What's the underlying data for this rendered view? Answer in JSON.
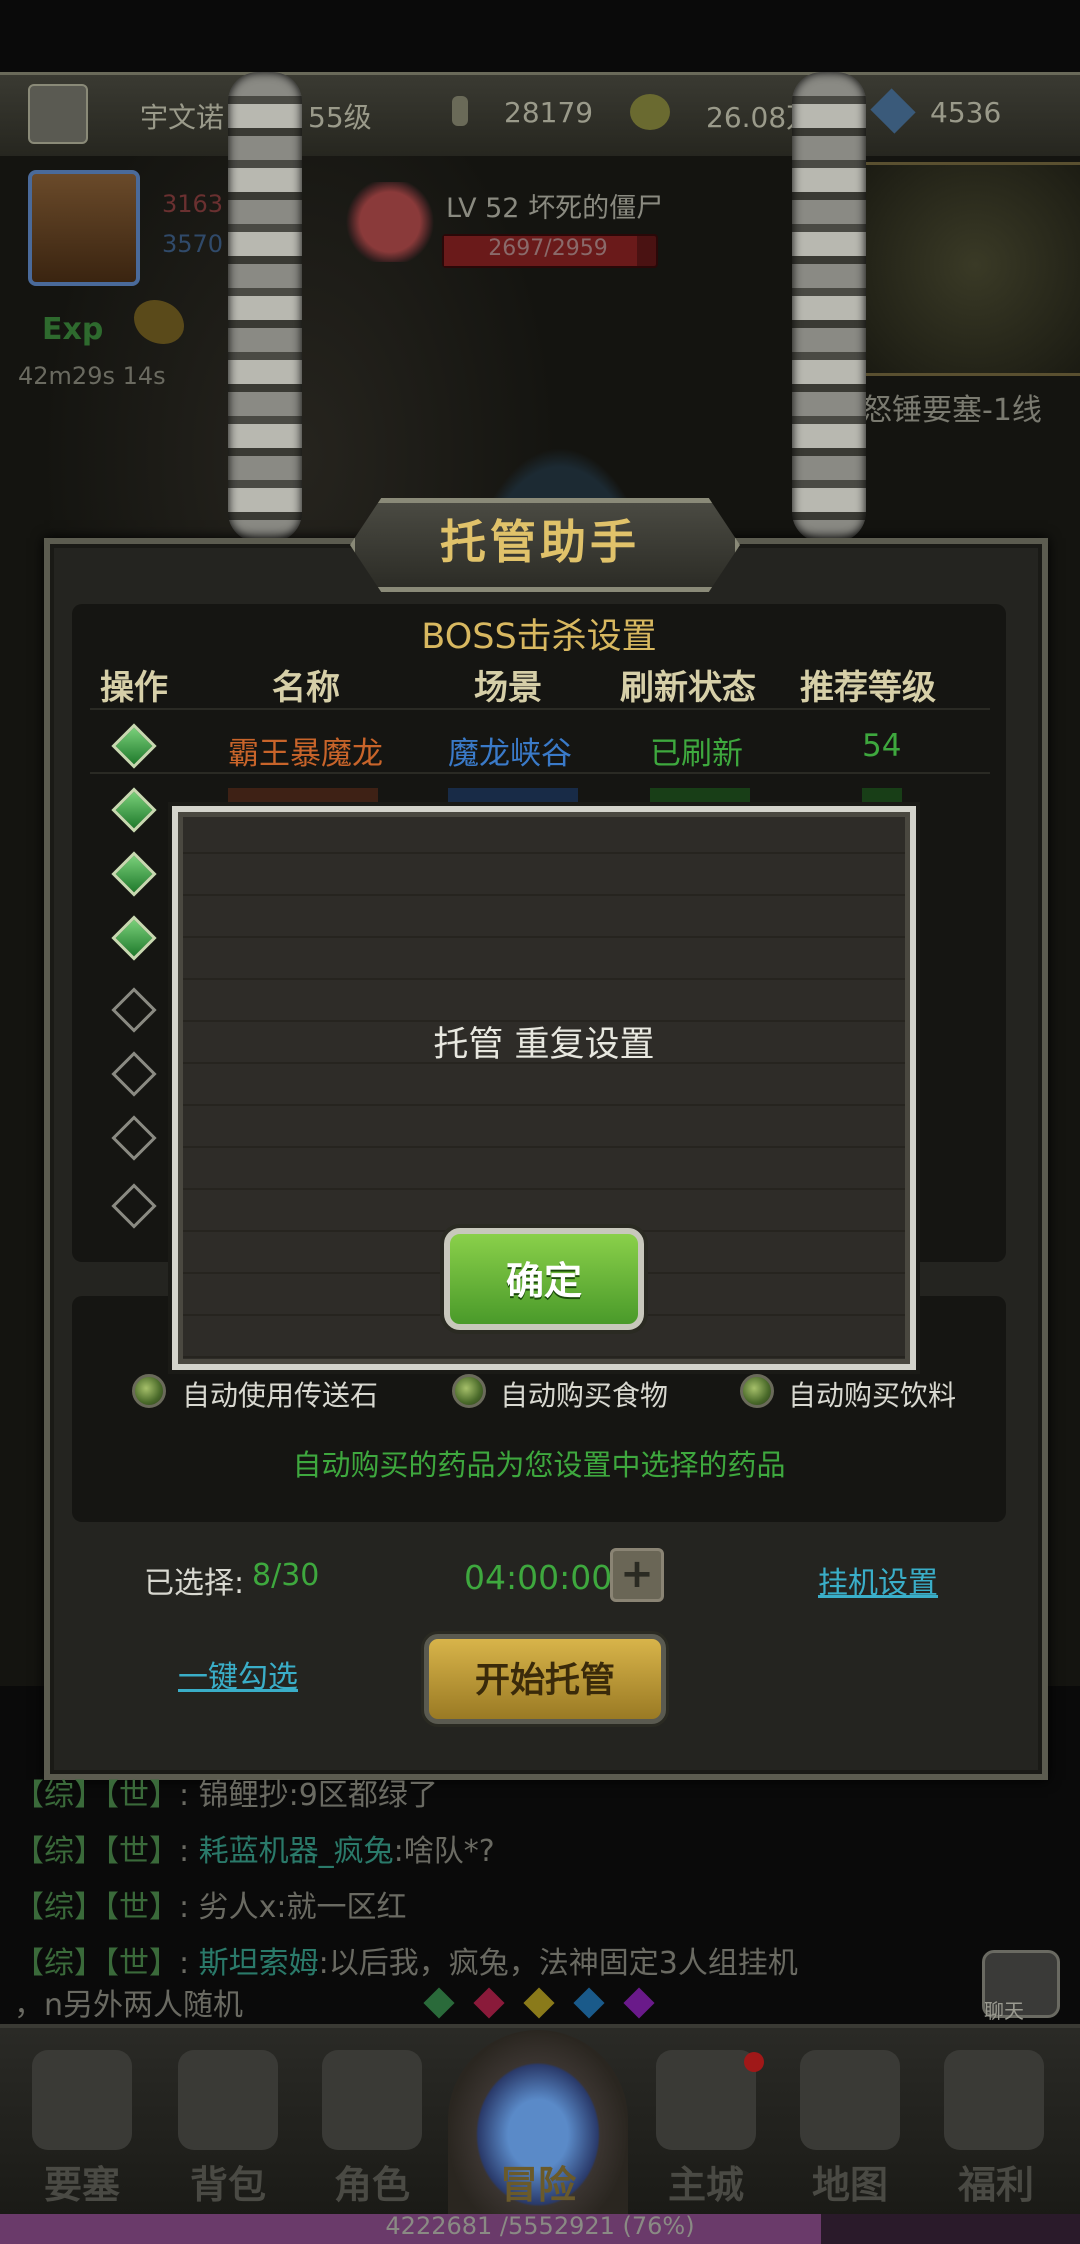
{
  "player": {
    "name": "宇文诺",
    "level": "55级",
    "gold": "28179",
    "coins": "26.08万",
    "diamonds": "4536"
  },
  "hero": {
    "hp_partial": "3163",
    "mp_partial": "3570",
    "exp_label": "Exp",
    "timers": "42m29s 14s"
  },
  "boss": {
    "level_name": "LV 52 坏死的僵尸",
    "hp": "2697/2959",
    "hp_fraction": 0.911
  },
  "map": {
    "line": "怒锤要塞-1线"
  },
  "panel": {
    "title": "托管助手",
    "section_title": "BOSS击杀设置",
    "columns": [
      "操作",
      "名称",
      "场景",
      "刷新状态",
      "推荐等级"
    ],
    "rows": [
      {
        "checked": true,
        "name": "霸王暴魔龙",
        "scene": "魔龙峡谷",
        "status": "已刷新",
        "level": "54"
      },
      {
        "checked": true,
        "name": "",
        "scene": "",
        "status": "",
        "level": ""
      },
      {
        "checked": true,
        "name": "",
        "scene": "",
        "status": "",
        "level": ""
      },
      {
        "checked": true,
        "name": "",
        "scene": "",
        "status": "",
        "level": ""
      },
      {
        "checked": false,
        "name": "",
        "scene": "",
        "status": "",
        "level": ""
      },
      {
        "checked": false,
        "name": "",
        "scene": "",
        "status": "",
        "level": ""
      },
      {
        "checked": false,
        "name": "",
        "scene": "",
        "status": "",
        "level": ""
      },
      {
        "checked": false,
        "name": "",
        "scene": "",
        "status": "",
        "level": ""
      }
    ],
    "options": [
      {
        "label": "自动使用传送石",
        "selected": true
      },
      {
        "label": "自动购买食物",
        "selected": true
      },
      {
        "label": "自动购买饮料",
        "selected": true
      }
    ],
    "note": "自动购买的药品为您设置中选择的药品",
    "selected_label": "已选择:",
    "selected_value": "8/30",
    "duration": "04:00:00",
    "plus": "+",
    "auto_settings_link": "挂机设置",
    "select_all_link": "一键勾选",
    "start_button": "开始托管"
  },
  "dialog": {
    "message": "托管 重复设置",
    "ok_button": "确定"
  },
  "chat": {
    "messages": [
      {
        "channel": "【综】",
        "scope": "【世】",
        "sep": ":",
        "sender": "",
        "text": "锦鲤抄:9区都绿了"
      },
      {
        "channel": "【综】",
        "scope": "【世】",
        "sep": ":",
        "sender": "耗蓝机器_疯兔",
        "text": ":啥队*?"
      },
      {
        "channel": "【综】",
        "scope": "【世】",
        "sep": ":",
        "sender": "",
        "text": "劣人x:就一区红"
      },
      {
        "channel": "【综】",
        "scope": "【世】",
        "sep": ":",
        "sender": "斯坦索姆",
        "text": ":以后我，疯兔，法神固定3人组挂机"
      }
    ],
    "continuation": "，n另外两人随机",
    "chat_button": "聊天"
  },
  "nav": {
    "items": [
      "要塞",
      "背包",
      "角色",
      "冒险",
      "主城",
      "地图",
      "福利"
    ]
  },
  "xp": {
    "text": "4222681 /5552921 (76%)",
    "fraction": 0.76
  },
  "colors": {
    "boss_name": "#c8642a",
    "scene": "#3a7ac8",
    "status": "#3ea83e",
    "level": "#3ea83e",
    "selected_value": "#3ea83e",
    "duration": "#3ea83e"
  }
}
